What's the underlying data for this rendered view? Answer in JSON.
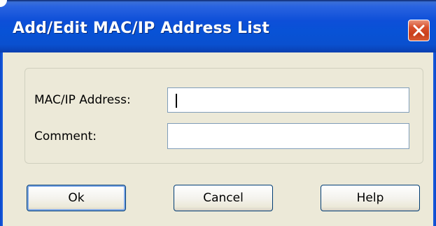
{
  "window": {
    "title": "Add/Edit MAC/IP Address List",
    "close_icon": "close-x-icon",
    "accent": "#0852d6"
  },
  "form": {
    "mac_ip_label": "MAC/IP Address:",
    "mac_ip_value": "",
    "comment_label": "Comment:",
    "comment_value": ""
  },
  "buttons": {
    "ok": "Ok",
    "cancel": "Cancel",
    "help": "Help"
  }
}
